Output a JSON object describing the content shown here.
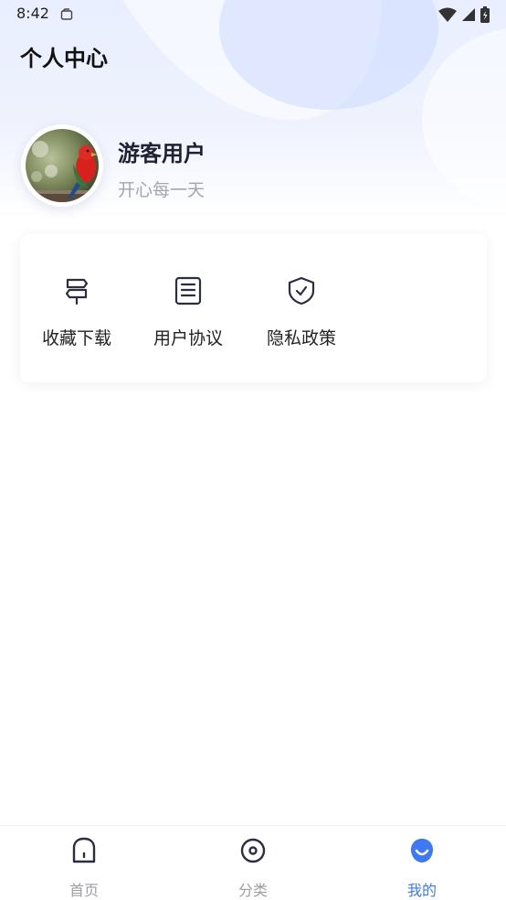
{
  "status_bar": {
    "time": "8:42"
  },
  "header": {
    "title": "个人中心"
  },
  "profile": {
    "name": "游客用户",
    "motto": "开心每一天"
  },
  "menu": {
    "items": [
      {
        "label": "收藏下载",
        "icon": "signpost-icon"
      },
      {
        "label": "用户协议",
        "icon": "document-icon"
      },
      {
        "label": "隐私政策",
        "icon": "shield-check-icon"
      }
    ]
  },
  "tabbar": {
    "tabs": [
      {
        "label": "首页",
        "icon": "home-icon",
        "active": false
      },
      {
        "label": "分类",
        "icon": "category-icon",
        "active": false
      },
      {
        "label": "我的",
        "icon": "profile-icon",
        "active": true
      }
    ]
  },
  "colors": {
    "accent": "#3e78f4",
    "inactive_tab": "#9c9ea6",
    "background_top": "#e9efff"
  }
}
